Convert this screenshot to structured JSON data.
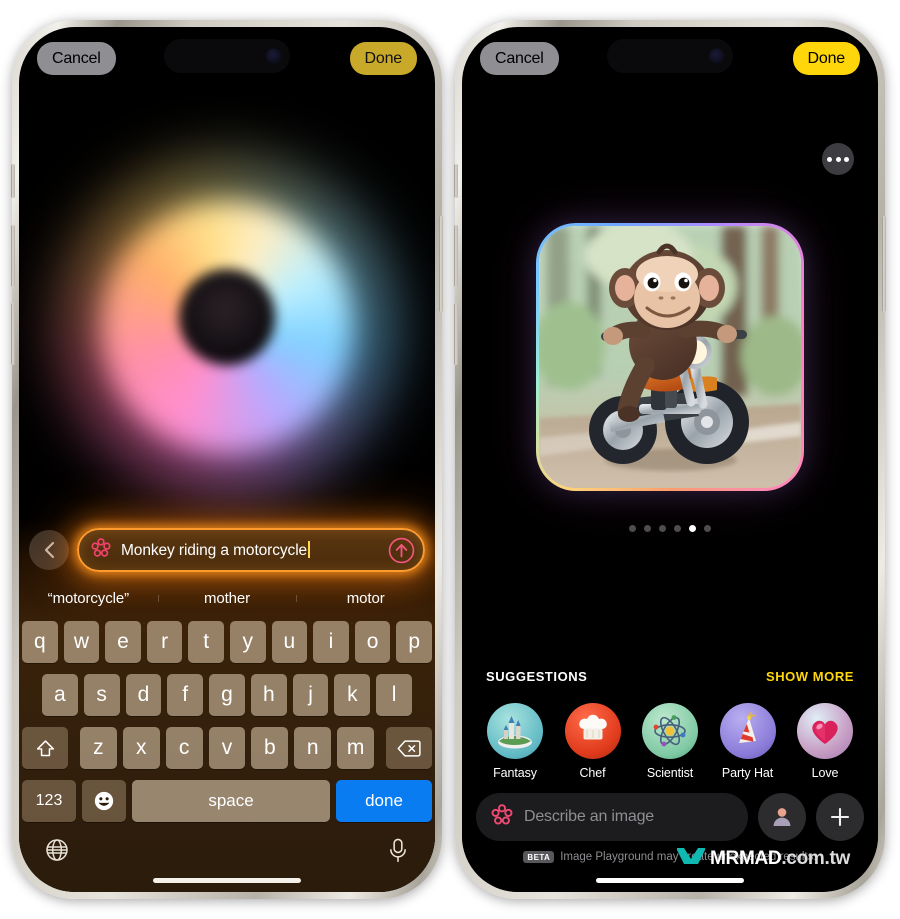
{
  "left_phone": {
    "navbar": {
      "cancel_label": "Cancel",
      "done_label": "Done"
    },
    "orb": {
      "name": "image-playground-generating-orb"
    },
    "prompt": {
      "back_icon": "chevron-left-icon",
      "leading_icon": "image-playground-flower-icon",
      "value": "Monkey riding a motorcycle",
      "send_icon": "arrow-up-circle-icon"
    },
    "autocomplete": [
      "“motorcycle”",
      "mother",
      "motor"
    ],
    "keyboard": {
      "row1": [
        "q",
        "w",
        "e",
        "r",
        "t",
        "y",
        "u",
        "i",
        "o",
        "p"
      ],
      "row2": [
        "a",
        "s",
        "d",
        "f",
        "g",
        "h",
        "j",
        "k",
        "l"
      ],
      "row3_letters": [
        "z",
        "x",
        "c",
        "v",
        "b",
        "n",
        "m"
      ],
      "shift_icon": "shift-up-arrow-icon",
      "backspace_icon": "backspace-delete-icon",
      "numbers_label": "123",
      "emoji_icon": "emoji-smiley-icon",
      "space_label": "space",
      "done_label": "done",
      "globe_icon": "globe-language-icon",
      "mic_icon": "microphone-dictation-icon"
    }
  },
  "right_phone": {
    "navbar": {
      "cancel_label": "Cancel",
      "done_label": "Done"
    },
    "menu_icon": "more-options-ellipsis-icon",
    "generated_image": {
      "alt": "Cartoon 3D monkey riding an orange motorcycle on a forest road"
    },
    "pagination": {
      "total": 6,
      "active_index": 4
    },
    "suggestions_header": {
      "title": "SUGGESTIONS",
      "show_more_label": "SHOW MORE"
    },
    "suggestions": [
      {
        "label": "Fantasy",
        "icon": "castle-icon",
        "glyph": "🏰",
        "bg": "#7fd4cf"
      },
      {
        "label": "Chef",
        "icon": "chef-hat-icon",
        "glyph": "👨‍🍳",
        "bg": "#e33b22"
      },
      {
        "label": "Scientist",
        "icon": "atom-icon",
        "glyph": "⚛",
        "bg": "#8fd4b4"
      },
      {
        "label": "Party Hat",
        "icon": "party-hat-icon",
        "glyph": "🎉",
        "bg": "#9a8ee0"
      },
      {
        "label": "Love",
        "icon": "heart-icon",
        "glyph": "❤",
        "bg": "#d8a8c8"
      }
    ],
    "compose": {
      "leading_icon": "image-playground-flower-icon",
      "placeholder": "Describe an image",
      "person_icon": "person-avatar-icon",
      "add_icon": "plus-add-icon"
    },
    "disclaimer": {
      "badge": "BETA",
      "text": "Image Playground may create unexpected results."
    }
  },
  "watermark": {
    "icon": "mrmad-logo-icon",
    "primary": "MRMAD",
    "secondary": ".com.tw"
  },
  "colors": {
    "accent_yellow": "#ffd60a",
    "accent_yellow_dim": "#c9a92a",
    "prompt_glow_orange": "#ff9b2e",
    "keyboard_blue": "#0a7cf2",
    "cancel_gray": "#8e8e93"
  }
}
